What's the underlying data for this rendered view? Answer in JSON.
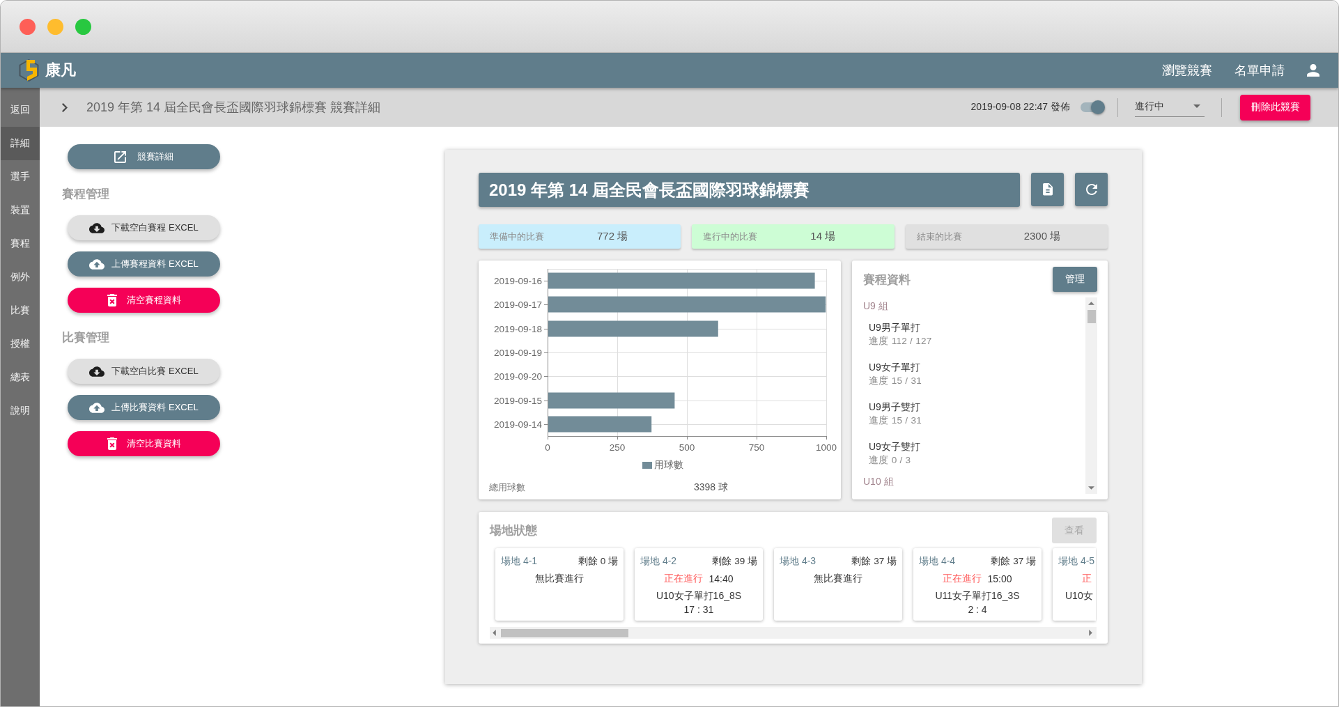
{
  "window": {
    "controls": [
      {
        "kind": "close"
      },
      {
        "kind": "minimize"
      },
      {
        "kind": "zoom"
      }
    ]
  },
  "header": {
    "brand": "康凡",
    "nav": [
      {
        "label": "瀏覽競賽"
      },
      {
        "label": "名單申請"
      }
    ]
  },
  "sidebar": {
    "items": [
      {
        "label": "返回",
        "selected": false
      },
      {
        "label": "詳細",
        "selected": true
      },
      {
        "label": "選手",
        "selected": false
      },
      {
        "label": "裝置",
        "selected": false
      },
      {
        "label": "賽程",
        "selected": false
      },
      {
        "label": "例外",
        "selected": false
      },
      {
        "label": "比賽",
        "selected": false
      },
      {
        "label": "授權",
        "selected": false
      },
      {
        "label": "總表",
        "selected": false
      },
      {
        "label": "說明",
        "selected": false
      }
    ]
  },
  "toolbar": {
    "breadcrumb": "2019 年第 14 屆全民會長盃國際羽球錦標賽 競賽詳細",
    "published": "2019-09-08 22:47 發佈",
    "publish_toggle": {
      "on": true
    },
    "status_select": {
      "value": "進行中"
    },
    "delete_button": "刪除此競賽"
  },
  "actions": {
    "detail_button": "競賽詳細",
    "sections": [
      {
        "heading": "賽程管理",
        "buttons": [
          {
            "kind": "download",
            "label": "下載空白賽程 EXCEL"
          },
          {
            "kind": "upload",
            "label": "上傳賽程資料 EXCEL"
          },
          {
            "kind": "clear",
            "label": "清空賽程資料"
          }
        ]
      },
      {
        "heading": "比賽管理",
        "buttons": [
          {
            "kind": "download",
            "label": "下載空白比賽 EXCEL"
          },
          {
            "kind": "upload",
            "label": "上傳比賽資料 EXCEL"
          },
          {
            "kind": "clear",
            "label": "清空比賽資料"
          }
        ]
      }
    ]
  },
  "competition": {
    "title": "2019 年第 14 屆全民會長盃國際羽球錦標賽",
    "stats": [
      {
        "label": "準備中的比賽",
        "value": "772 場",
        "color": "#c9eefc"
      },
      {
        "label": "進行中的比賽",
        "value": "14 場",
        "color": "#cdfdd5"
      },
      {
        "label": "結束的比賽",
        "value": "2300 場",
        "color": "#e0e0e0"
      }
    ],
    "chart": {
      "chart_data": {
        "type": "bar",
        "orientation": "horizontal",
        "grid": true,
        "categories": [
          "2019-09-16",
          "2019-09-17",
          "2019-09-18",
          "2019-09-19",
          "2019-09-20",
          "2019-09-15",
          "2019-09-14"
        ],
        "series": [
          {
            "name": "用球數",
            "color": "#728c98",
            "values": [
              959,
              998,
              612,
              0,
              0,
              456,
              373
            ]
          }
        ],
        "xlim": [
          0,
          1000
        ],
        "xticks": [
          0,
          250,
          500,
          750,
          1000
        ]
      },
      "total_label": "總用球數",
      "total_value": "3398 球"
    },
    "schedule": {
      "title": "賽程資料",
      "manage_button": "管理",
      "groups": [
        {
          "name": "U9 組",
          "children": [
            {
              "name": "U9男子單打",
              "progress": "進度 112 / 127"
            },
            {
              "name": "U9女子單打",
              "progress": "進度 15 / 31"
            },
            {
              "name": "U9男子雙打",
              "progress": "進度 15 / 31"
            },
            {
              "name": "U9女子雙打",
              "progress": "進度 0 / 3"
            }
          ]
        },
        {
          "name": "U10 組"
        }
      ]
    },
    "courts": {
      "title": "場地狀態",
      "view_button": {
        "label": "查看",
        "disabled": true
      },
      "items": [
        {
          "kind": "idle",
          "name": "場地 4-1",
          "remaining": "剩餘 0 場",
          "status": "無比賽進行"
        },
        {
          "kind": "playing",
          "name": "場地 4-2",
          "remaining": "剩餘 39 場",
          "status": "正在進行",
          "time": "14:40",
          "match": "U10女子單打16_8S",
          "score": "17 : 31"
        },
        {
          "kind": "idle",
          "name": "場地 4-3",
          "remaining": "剩餘 37 場",
          "status": "無比賽進行"
        },
        {
          "kind": "playing",
          "name": "場地 4-4",
          "remaining": "剩餘 37 場",
          "status": "正在進行",
          "time": "15:00",
          "match": "U11女子單打16_3S",
          "score": "2 : 4"
        },
        {
          "kind": "cut",
          "name": "場地 4-5",
          "status": "正",
          "match": "U10女"
        }
      ]
    }
  }
}
